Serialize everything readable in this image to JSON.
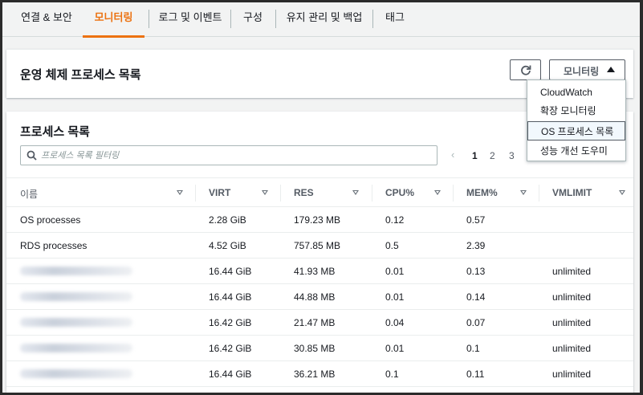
{
  "tabs": [
    {
      "label": "연결 & 보안"
    },
    {
      "label": "모니터링"
    },
    {
      "label": "로그 및 이벤트"
    },
    {
      "label": "구성"
    },
    {
      "label": "유지 관리 및 백업"
    },
    {
      "label": "태그"
    }
  ],
  "active_tab": "모니터링",
  "header_panel": {
    "title": "운영 체제 프로세스 목록",
    "refresh_icon": "refresh-icon",
    "monitoring_button": "모니터링"
  },
  "dropdown": {
    "items": [
      {
        "label": "CloudWatch"
      },
      {
        "label": "확장 모니터링"
      },
      {
        "label": "OS 프로세스 목록"
      },
      {
        "label": "성능 개선 도우미"
      }
    ],
    "selected": "OS 프로세스 목록"
  },
  "process_panel": {
    "title": "프로세스 목록",
    "search_placeholder": "프로세스 목록 필터링",
    "pages": [
      "1",
      "2",
      "3"
    ],
    "current_page": "1",
    "columns": [
      "이름",
      "VIRT",
      "RES",
      "CPU%",
      "MEM%",
      "VMLIMIT"
    ],
    "rows": [
      {
        "name": "OS processes",
        "virt": "2.28 GiB",
        "res": "179.23 MB",
        "cpu": "0.12",
        "mem": "0.57",
        "vmlimit": ""
      },
      {
        "name": "RDS processes",
        "virt": "4.52 GiB",
        "res": "757.85 MB",
        "cpu": "0.5",
        "mem": "2.39",
        "vmlimit": ""
      },
      {
        "name": "",
        "virt": "16.44 GiB",
        "res": "41.93 MB",
        "cpu": "0.01",
        "mem": "0.13",
        "vmlimit": "unlimited"
      },
      {
        "name": "",
        "virt": "16.44 GiB",
        "res": "44.88 MB",
        "cpu": "0.01",
        "mem": "0.14",
        "vmlimit": "unlimited"
      },
      {
        "name": "",
        "virt": "16.42 GiB",
        "res": "21.47 MB",
        "cpu": "0.04",
        "mem": "0.07",
        "vmlimit": "unlimited"
      },
      {
        "name": "",
        "virt": "16.42 GiB",
        "res": "30.85 MB",
        "cpu": "0.01",
        "mem": "0.1",
        "vmlimit": "unlimited"
      },
      {
        "name": "",
        "virt": "16.44 GiB",
        "res": "36.21 MB",
        "cpu": "0.1",
        "mem": "0.11",
        "vmlimit": "unlimited"
      }
    ]
  },
  "colors": {
    "accent": "#ec7211",
    "text": "#16191f",
    "border": "#eaeded"
  }
}
